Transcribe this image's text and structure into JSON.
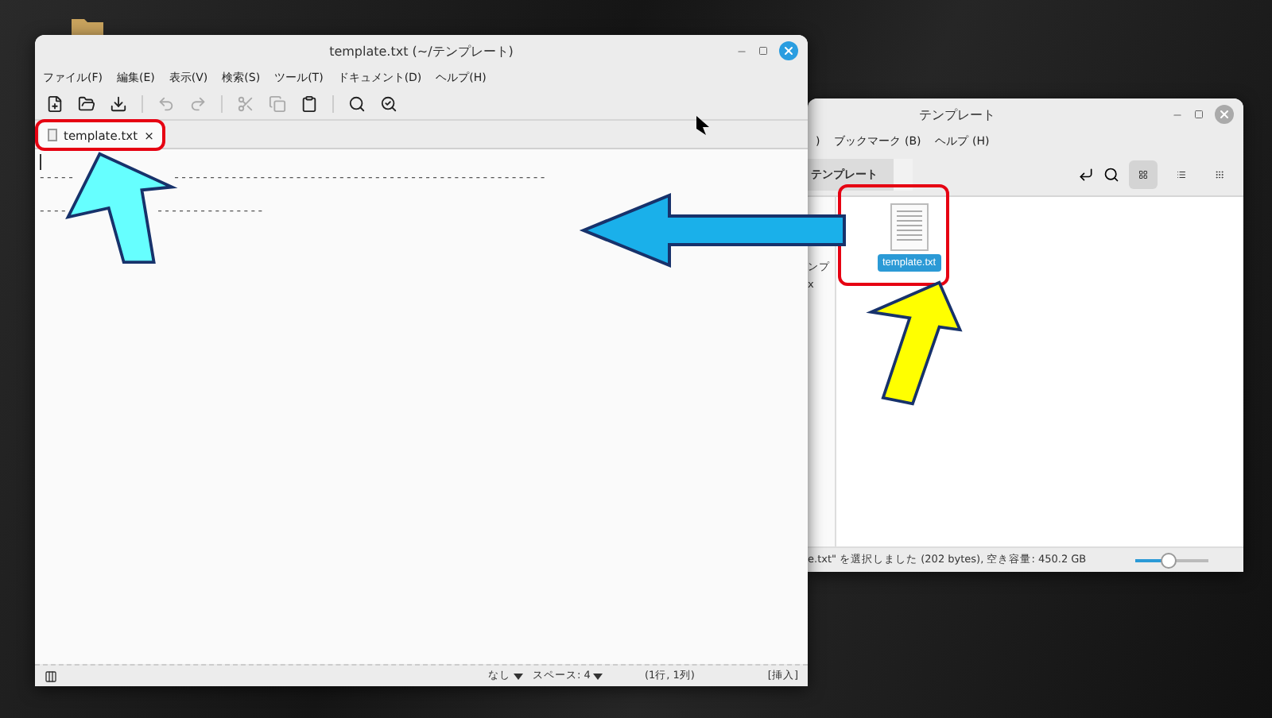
{
  "editor": {
    "title": "template.txt (~/テンプレート)",
    "menu": [
      "ファイル(F)",
      "編集(E)",
      "表示(V)",
      "検索(S)",
      "ツール(T)",
      "ドキュメント(D)",
      "ヘルプ(H)"
    ],
    "toolbar": [
      {
        "kind": "new",
        "disabled": false
      },
      {
        "kind": "open",
        "disabled": false
      },
      {
        "kind": "save",
        "disabled": false
      },
      {
        "kind": "undo",
        "disabled": true
      },
      {
        "kind": "redo",
        "disabled": true
      },
      {
        "kind": "cut",
        "disabled": true
      },
      {
        "kind": "copy",
        "disabled": true
      },
      {
        "kind": "paste",
        "disabled": false
      },
      {
        "kind": "search",
        "disabled": false
      },
      {
        "kind": "replace",
        "disabled": false
      }
    ],
    "tabs": [
      {
        "label": "template.txt",
        "close": "×",
        "selected": true
      }
    ],
    "lines": [
      {
        "segments": [
          "-----",
          "----------------------------------------------------"
        ]
      },
      {
        "segments": [
          "----",
          "---------------"
        ]
      }
    ],
    "status": {
      "encoding": "なし",
      "spaces": "スペース: 4",
      "position": "(1行, 1列)",
      "mode": "[挿入]"
    }
  },
  "file_manager": {
    "title": "テンプレート",
    "menu": [
      ")",
      "ブックマーク (B)",
      "ヘルプ (H)"
    ],
    "path": [
      {
        "label": "テンプレート",
        "selected": true
      }
    ],
    "view_modes": [
      {
        "kind": "grid",
        "selected": true
      },
      {
        "kind": "list",
        "selected": false
      },
      {
        "kind": "compact",
        "selected": false
      }
    ],
    "sidebar": [
      "ンプ",
      "x"
    ],
    "files": [
      {
        "name": "template.txt",
        "selected": true
      }
    ],
    "status": "e.txt\" を選択しました (202 bytes), 空き容量: 450.2 GB",
    "zoom": {
      "level": 0.45
    }
  }
}
